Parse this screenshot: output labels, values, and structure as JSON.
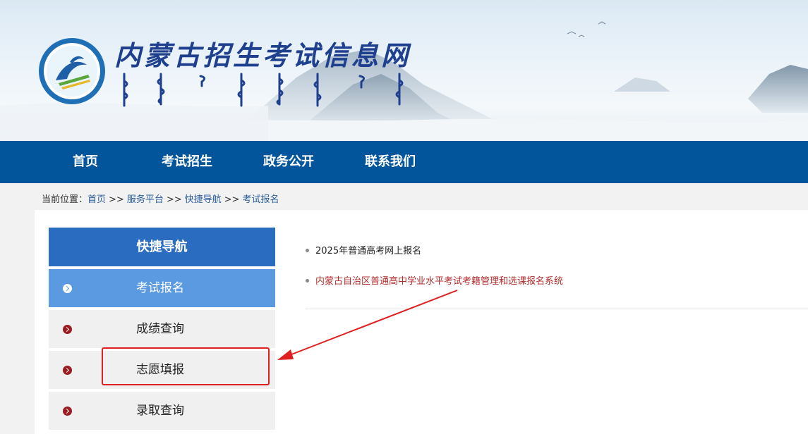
{
  "site": {
    "title": "内蒙古招生考试信息网",
    "logo_icon": "exam-authority-logo-icon"
  },
  "nav": {
    "items": [
      {
        "label": "首页"
      },
      {
        "label": "考试招生"
      },
      {
        "label": "政务公开"
      },
      {
        "label": "联系我们"
      }
    ]
  },
  "breadcrumb": {
    "prefix": "当前位置：",
    "items": [
      "首页",
      "服务平台",
      "快捷导航",
      "考试报名"
    ],
    "separator": ">>"
  },
  "sidebar": {
    "title": "快捷导航",
    "items": [
      {
        "label": "考试报名",
        "active": true
      },
      {
        "label": "成绩查询",
        "active": false
      },
      {
        "label": "志愿填报",
        "active": false
      },
      {
        "label": "录取查询",
        "active": false
      }
    ]
  },
  "links": [
    {
      "label": "2025年普通高考网上报名"
    },
    {
      "label": "内蒙古自治区普通高中学业水平考试考籍管理和选课报名系统"
    }
  ],
  "colors": {
    "nav_bg": "#02559b",
    "sidebar_header": "#2a6cbf",
    "sidebar_active": "#5b9ae0",
    "link_highlight": "#b32c2c",
    "annotation": "#e02020"
  }
}
